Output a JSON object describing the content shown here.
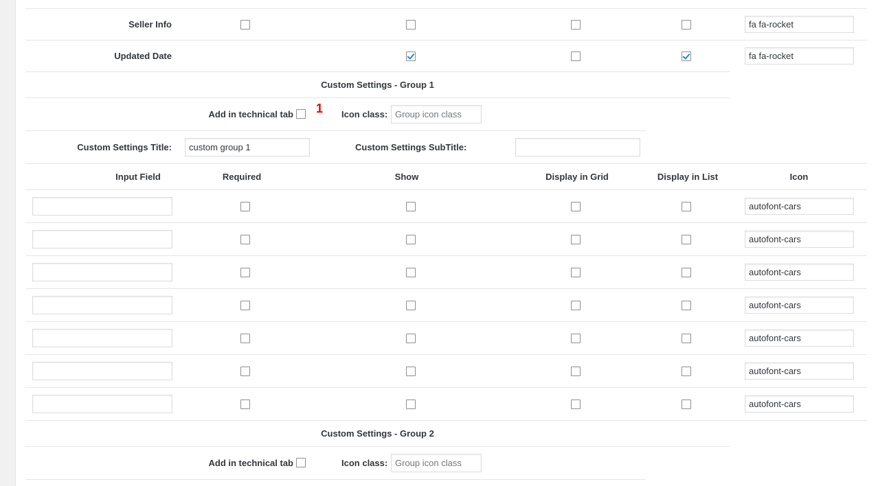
{
  "rows_top": [
    {
      "label": "Seller Info",
      "required": false,
      "show": false,
      "grid": false,
      "list": false,
      "icon": "fa fa-rocket"
    },
    {
      "label": "Updated Date",
      "required": null,
      "show": true,
      "grid": false,
      "list": true,
      "icon": "fa fa-rocket"
    }
  ],
  "group1": {
    "heading": "Custom Settings - Group 1",
    "add_tech_tab_label": "Add in technical tab",
    "add_tech_tab_checked": false,
    "badge": "1",
    "icon_class_label": "Icon class:",
    "icon_class_placeholder": "Group icon class",
    "title_label": "Custom Settings Title:",
    "title_value": "custom group 1",
    "subtitle_label": "Custom Settings SubTitle:",
    "subtitle_value": ""
  },
  "table_headers": {
    "input_field": "Input Field",
    "required": "Required",
    "show": "Show",
    "grid": "Display in Grid",
    "list": "Display in List",
    "icon": "Icon"
  },
  "custom_rows": [
    {
      "input": "",
      "required": false,
      "show": false,
      "grid": false,
      "list": false,
      "icon": "autofont-cars"
    },
    {
      "input": "",
      "required": false,
      "show": false,
      "grid": false,
      "list": false,
      "icon": "autofont-cars"
    },
    {
      "input": "",
      "required": false,
      "show": false,
      "grid": false,
      "list": false,
      "icon": "autofont-cars"
    },
    {
      "input": "",
      "required": false,
      "show": false,
      "grid": false,
      "list": false,
      "icon": "autofont-cars"
    },
    {
      "input": "",
      "required": false,
      "show": false,
      "grid": false,
      "list": false,
      "icon": "autofont-cars"
    },
    {
      "input": "",
      "required": false,
      "show": false,
      "grid": false,
      "list": false,
      "icon": "autofont-cars"
    },
    {
      "input": "",
      "required": false,
      "show": false,
      "grid": false,
      "list": false,
      "icon": "autofont-cars"
    }
  ],
  "group2": {
    "heading": "Custom Settings - Group 2",
    "add_tech_tab_label": "Add in technical tab",
    "add_tech_tab_checked": false,
    "icon_class_label": "Icon class:",
    "icon_class_placeholder": "Group icon class"
  },
  "colors": {
    "accent": "#1e8cbe",
    "badge": "#ee0000",
    "border": "#e5e5e5"
  }
}
